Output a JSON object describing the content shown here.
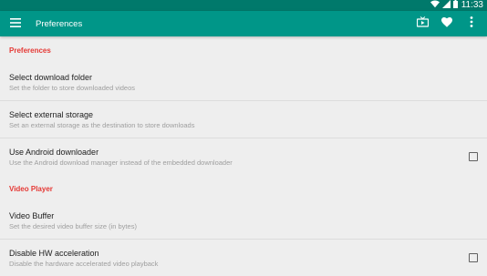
{
  "status_bar": {
    "time": "11:33",
    "icons": [
      "wifi-icon",
      "signal-icon",
      "battery-icon"
    ]
  },
  "app_bar": {
    "title": "Preferences",
    "nav_icon": "menu-icon",
    "action_icons": [
      "cast-tv-icon",
      "heart-icon",
      "more-vert-icon"
    ]
  },
  "sections": [
    {
      "header": "Preferences"
    },
    {
      "header": "Video Player"
    }
  ],
  "prefs": {
    "download_folder": {
      "title": "Select download folder",
      "summary": "Set the folder to store downloaded videos"
    },
    "external_storage": {
      "title": "Select external storage",
      "summary": "Set an external storage as the destination to store downloads"
    },
    "android_downloader": {
      "title": "Use Android downloader",
      "summary": "Use the Android download manager instead of the embedded downloader",
      "checked": false
    },
    "video_buffer": {
      "title": "Video Buffer",
      "summary": "Set the desired video buffer size (in bytes)"
    },
    "disable_hw": {
      "title": "Disable HW acceleration",
      "summary": "Disable the hardware accelerated video playback",
      "checked": false
    }
  },
  "colors": {
    "status_bar": "#00796b",
    "app_bar": "#009688",
    "section_header": "#e53935",
    "background": "#eeeeee"
  }
}
